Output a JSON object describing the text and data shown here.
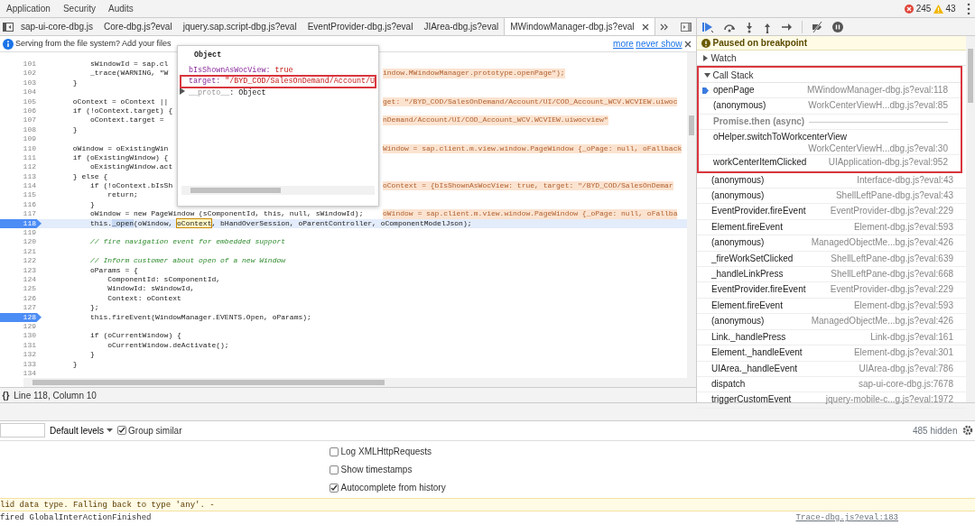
{
  "menu_bar": {
    "tabs": [
      {
        "label": "Application"
      },
      {
        "label": "Security"
      },
      {
        "label": "Audits"
      }
    ],
    "errors": "245",
    "warnings": "43"
  },
  "file_tabs": [
    {
      "label": "sap-ui-core-dbg.js",
      "selected": false
    },
    {
      "label": "Core-dbg.js?eval",
      "selected": false
    },
    {
      "label": "jquery.sap.script-dbg.js?eval",
      "selected": false
    },
    {
      "label": "EventProvider-dbg.js?eval",
      "selected": false
    },
    {
      "label": "JIArea-dbg.js?eval",
      "selected": false
    },
    {
      "label": "MWindowManager-dbg.js?eval",
      "selected": true
    }
  ],
  "info_bar": {
    "message": "Serving from the file system? Add your files",
    "links": [
      "more",
      "never show"
    ]
  },
  "editor": {
    "lines": [
      {
        "number": "101",
        "text": "          sWindowId = sap.cl",
        "breakpoint": false,
        "current": false
      },
      {
        "number": "102",
        "text": "          _trace(WARNING, \"W",
        "tail": "indow.MWindowManager.prototype.openPage\");",
        "breakpoint": false,
        "current": false
      },
      {
        "number": "103",
        "text": "      }",
        "breakpoint": false,
        "current": false
      },
      {
        "number": "104",
        "breakpoint": false,
        "current": false
      },
      {
        "number": "105",
        "text": "      oContext = oContext ||",
        "tail": "get: \"/BYD_COD/SalesOnDemand/Account/UI/COD_Account_WCV.WCVIEW.uiwoc",
        "breakpoint": false,
        "current": false
      },
      {
        "number": "106",
        "text": "      if (!oContext.target) {",
        "breakpoint": false,
        "current": false
      },
      {
        "number": "107",
        "text": "          oContext.target =",
        "tail": "nDemand/Account/UI/COD_Account_WCV.WCVIEW.uiwocview\"",
        "breakpoint": false,
        "current": false
      },
      {
        "number": "108",
        "text": "      }",
        "breakpoint": false,
        "current": false
      },
      {
        "number": "109",
        "breakpoint": false,
        "current": false
      },
      {
        "number": "110",
        "text": "      oWindow = oExistingWin",
        "tail": "Window = sap.client.m.view.window.PageWindow {_oPage: null, oFallback",
        "breakpoint": false,
        "current": false
      },
      {
        "number": "111",
        "text": "      if (oExistingWindow) {",
        "breakpoint": false,
        "current": false
      },
      {
        "number": "112",
        "text": "          oExistingWindow.act",
        "breakpoint": false,
        "current": false
      },
      {
        "number": "113",
        "text": "      } else {",
        "breakpoint": false,
        "current": false
      },
      {
        "number": "114",
        "text": "          if (!oContext.bIsSh",
        "tail": "oContext = {bIsShownAsWocView: true, target: \"/BYD_COD/SalesOnDemar",
        "breakpoint": false,
        "current": false
      },
      {
        "number": "115",
        "text": "              return;",
        "breakpoint": false,
        "current": false
      },
      {
        "number": "116",
        "text": "          }",
        "breakpoint": false,
        "current": false
      },
      {
        "number": "117",
        "text": "          oWindow = new PageWindow (sComponentId, this, null, sWindowId);",
        "tail": "oWindow = sap.client.m.view.window.PageWindow {_oPage: null, oFallba",
        "breakpoint": false,
        "current": false
      },
      {
        "number": "118",
        "parts": [
          {
            "kind": "plain",
            "text": "          this."
          },
          {
            "kind": "selection",
            "text": "_open"
          },
          {
            "kind": "plain",
            "text": "(oWindow, "
          },
          {
            "kind": "hover",
            "text": "oContext"
          },
          {
            "kind": "plain",
            "text": ", bHandOverSession, oParentController, oComponentModelJson);"
          }
        ],
        "breakpoint": true,
        "current": true
      },
      {
        "number": "119",
        "breakpoint": false,
        "current": false
      },
      {
        "number": "120",
        "text": "          // fire navigation event for embedded support",
        "kind": "comment",
        "breakpoint": false,
        "current": false
      },
      {
        "number": "121",
        "breakpoint": false,
        "current": false
      },
      {
        "number": "122",
        "text": "          // Inform customer about open of a new Window",
        "kind": "comment",
        "breakpoint": false,
        "current": false
      },
      {
        "number": "123",
        "text": "          oParams = {",
        "breakpoint": false,
        "current": false
      },
      {
        "number": "124",
        "text": "              ComponentId: sComponentId,",
        "breakpoint": false,
        "current": false
      },
      {
        "number": "125",
        "text": "              WindowId: sWindowId,",
        "breakpoint": false,
        "current": false
      },
      {
        "number": "126",
        "text": "              Context: oContext",
        "breakpoint": false,
        "current": false
      },
      {
        "number": "127",
        "text": "          };",
        "breakpoint": false,
        "current": false
      },
      {
        "number": "128",
        "text": "          this.fireEvent(WindowManager.EVENTS.Open, oParams);",
        "breakpoint": true,
        "current": false
      },
      {
        "number": "129",
        "breakpoint": false,
        "current": false
      },
      {
        "number": "130",
        "text": "          if (oCurrentWindow) {",
        "breakpoint": false,
        "current": false
      },
      {
        "number": "131",
        "text": "              oCurrentWindow.deActivate();",
        "breakpoint": false,
        "current": false
      },
      {
        "number": "132",
        "text": "          }",
        "breakpoint": false,
        "current": false
      },
      {
        "number": "133",
        "text": "      }",
        "breakpoint": false,
        "current": false
      },
      {
        "number": "134",
        "breakpoint": false,
        "current": false
      }
    ]
  },
  "popover": {
    "title": "Object",
    "properties": [
      {
        "kind": "property",
        "key": "bIsShownAsWocView:",
        "value": "true",
        "highlighted": false
      },
      {
        "kind": "property",
        "key": "target:",
        "value": "\"/BYD_COD/SalesOnDemand/Account/U",
        "highlighted": true
      },
      {
        "kind": "prototype",
        "key": "__proto__",
        "value": ": Object",
        "highlighted": false
      }
    ]
  },
  "status_bar": {
    "format_button": "{}",
    "position": "Line 118, Column 10"
  },
  "debugger": {
    "toolbar": [
      {
        "kind": "resume"
      },
      {
        "kind": "step-over"
      },
      {
        "kind": "step-into"
      },
      {
        "kind": "step-out"
      },
      {
        "kind": "step"
      },
      {
        "kind": "deactivate"
      },
      {
        "kind": "pause-exceptions"
      }
    ],
    "paused_message": "Paused on breakpoint",
    "watch": {
      "label": "Watch",
      "expanded": false
    },
    "call_stack": {
      "label": "Call Stack",
      "expanded": true,
      "highlighted": true,
      "frames": [
        {
          "kind": "frame",
          "name": "openPage",
          "location": "MWindowManager-dbg.js?eval:118",
          "selected": true,
          "highlighted": true
        },
        {
          "kind": "frame",
          "name": "(anonymous)",
          "location": "WorkCenterViewH...dbg.js?eval:85",
          "selected": false,
          "highlighted": true
        },
        {
          "kind": "async",
          "name": "Promise.then (async)",
          "selected": false,
          "highlighted": true
        },
        {
          "kind": "long-frame",
          "name": "oHelper.switchToWorkcenterView",
          "location": "WorkCenterViewH...dbg.js?eval:30",
          "selected": false,
          "highlighted": true
        },
        {
          "kind": "frame",
          "name": "workCenterItemClicked",
          "location": "UIApplication-dbg.js?eval:952",
          "selected": false,
          "highlighted": true
        },
        {
          "kind": "frame",
          "name": "(anonymous)",
          "location": "Interface-dbg.js?eval:43",
          "selected": false,
          "highlighted": false
        },
        {
          "kind": "frame",
          "name": "(anonymous)",
          "location": "ShellLeftPane-dbg.js?eval:43",
          "selected": false,
          "highlighted": false
        },
        {
          "kind": "frame",
          "name": "EventProvider.fireEvent",
          "location": "EventProvider-dbg.js?eval:229",
          "selected": false,
          "highlighted": false
        },
        {
          "kind": "frame",
          "name": "Element.fireEvent",
          "location": "Element-dbg.js?eval:593",
          "selected": false,
          "highlighted": false
        },
        {
          "kind": "frame",
          "name": "(anonymous)",
          "location": "ManagedObjectMe...bg.js?eval:426",
          "selected": false,
          "highlighted": false
        },
        {
          "kind": "frame",
          "name": "_fireWorkSetClicked",
          "location": "ShellLeftPane-dbg.js?eval:639",
          "selected": false,
          "highlighted": false
        },
        {
          "kind": "frame",
          "name": "_handleLinkPress",
          "location": "ShellLeftPane-dbg.js?eval:668",
          "selected": false,
          "highlighted": false
        },
        {
          "kind": "frame",
          "name": "EventProvider.fireEvent",
          "location": "EventProvider-dbg.js?eval:229",
          "selected": false,
          "highlighted": false
        },
        {
          "kind": "frame",
          "name": "Element.fireEvent",
          "location": "Element-dbg.js?eval:593",
          "selected": false,
          "highlighted": false
        },
        {
          "kind": "frame",
          "name": "(anonymous)",
          "location": "ManagedObjectMe...bg.js?eval:426",
          "selected": false,
          "highlighted": false
        },
        {
          "kind": "frame",
          "name": "Link._handlePress",
          "location": "Link-dbg.js?eval:161",
          "selected": false,
          "highlighted": false
        },
        {
          "kind": "frame",
          "name": "Element._handleEvent",
          "location": "Element-dbg.js?eval:301",
          "selected": false,
          "highlighted": false
        },
        {
          "kind": "frame",
          "name": "UIArea._handleEvent",
          "location": "UIArea-dbg.js?eval:786",
          "selected": false,
          "highlighted": false
        },
        {
          "kind": "frame",
          "name": "dispatch",
          "location": "sap-ui-core-dbg.js:7678",
          "selected": false,
          "highlighted": false
        },
        {
          "kind": "frame",
          "name": "triggerCustomEvent",
          "location": "jquery-mobile-c...g.js?eval:1972",
          "selected": false,
          "highlighted": false
        }
      ]
    }
  },
  "console": {
    "level_filter": "Default levels",
    "group_similar": {
      "label": "Group similar",
      "checked": true
    },
    "hidden_count": "485 hidden",
    "settings": [
      {
        "label": "Log XMLHttpRequests",
        "checked": false
      },
      {
        "label": "Show timestamps",
        "checked": false
      },
      {
        "label": "Autocomplete from history",
        "checked": true
      }
    ],
    "messages": [
      {
        "kind": "warning",
        "text": "lid data type. Falling back to type 'any'. -"
      },
      {
        "kind": "log",
        "text": "fired GlobalInterActionFinished",
        "source": "Trace-dbg.js?eval:183"
      }
    ]
  }
}
